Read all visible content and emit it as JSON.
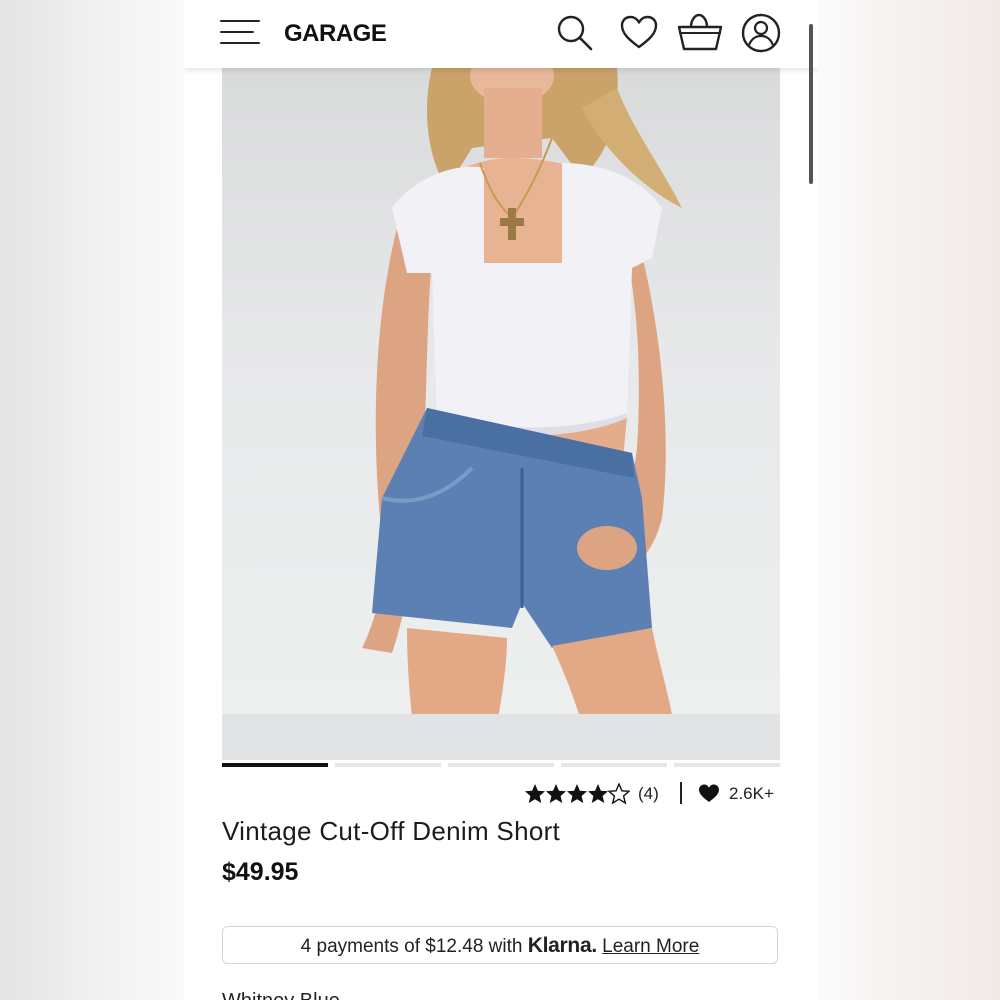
{
  "header": {
    "logo": "GARAGE",
    "icons": [
      "menu-icon",
      "search-icon",
      "heart-icon",
      "cart-icon",
      "account-icon"
    ]
  },
  "carousel": {
    "slide_count": 5,
    "active_index": 0
  },
  "product": {
    "rating": 4,
    "rating_max": 5,
    "reviews": "(4)",
    "favorites": "2.6K+",
    "title": "Vintage Cut-Off Denim Short",
    "price": "$49.95"
  },
  "klarna": {
    "text": "4 payments of $12.48 with ",
    "brand": "Klarna.",
    "link": "Learn More"
  },
  "color": {
    "label": "Whitney Blue"
  },
  "colors": {
    "accent": "#111111",
    "image_bg": "#e7e8e9",
    "border": "#d4d4d4"
  }
}
